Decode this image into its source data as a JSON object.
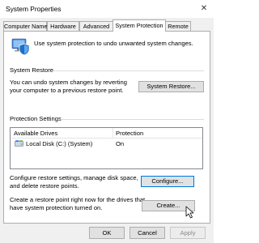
{
  "window": {
    "title": "System Properties",
    "close_glyph": "✕"
  },
  "tabs": [
    {
      "label": "Computer Name"
    },
    {
      "label": "Hardware"
    },
    {
      "label": "Advanced"
    },
    {
      "label": "System Protection"
    },
    {
      "label": "Remote"
    }
  ],
  "active_tab": "System Protection",
  "intro_text": "Use system protection to undo unwanted system changes.",
  "system_restore": {
    "heading": "System Restore",
    "description": "You can undo system changes by reverting your computer to a previous restore point.",
    "button": "System Restore..."
  },
  "protection_settings": {
    "heading": "Protection Settings",
    "columns": [
      "Available Drives",
      "Protection"
    ],
    "drives": [
      {
        "name": "Local Disk (C:) (System)",
        "protection": "On"
      }
    ],
    "configure_text": "Configure restore settings, manage disk space, and delete restore points.",
    "configure_button": "Configure...",
    "create_text": "Create a restore point right now for the drives that have system protection turned on.",
    "create_button": "Create..."
  },
  "footer": {
    "ok": "OK",
    "cancel": "Cancel",
    "apply": "Apply"
  },
  "colors": {
    "accent": "#0078d7",
    "shield_blue": "#1e6fc8",
    "shield_light": "#5fa8f0"
  }
}
